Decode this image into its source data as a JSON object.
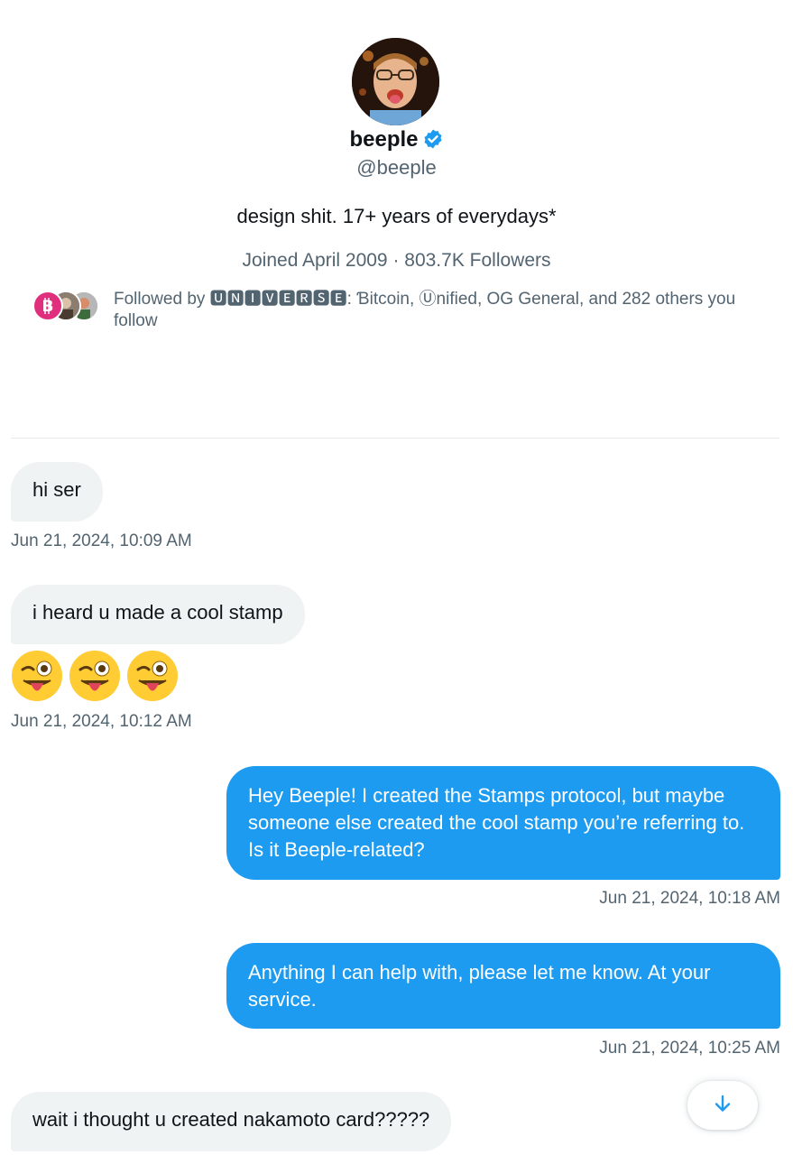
{
  "profile": {
    "name": "beeple",
    "handle": "@beeple",
    "bio": "design shit. 17+ years of everydays*",
    "meta": "Joined April 2009 · 803.7K Followers",
    "followed_by": "Followed by 🆄🅽🅸🆅🅴🆁🆂🅴: Ɓitcoin, Ⓤnified, OG General, and 282 others you follow"
  },
  "messages": [
    {
      "direction": "in",
      "text": "hi ser",
      "timestamp": "Jun 21, 2024, 10:09 AM"
    },
    {
      "direction": "in",
      "text": "i heard u made a cool stamp",
      "timestamp": ""
    },
    {
      "direction": "in",
      "emoji": "winking-face-with-tongue",
      "count": 3,
      "timestamp": "Jun 21, 2024, 10:12 AM"
    },
    {
      "direction": "out",
      "text": "Hey Beeple! I created the Stamps protocol, but maybe someone else created the cool stamp you’re referring to. Is it Beeple-related?",
      "timestamp": "Jun 21, 2024, 10:18 AM"
    },
    {
      "direction": "out",
      "text": "Anything I can help with, please let me know. At your service.",
      "timestamp": "Jun 21, 2024, 10:25 AM"
    },
    {
      "direction": "in",
      "text": "wait i thought u created nakamoto card?????",
      "timestamp": ""
    }
  ],
  "colors": {
    "accent": "#1d9bf0",
    "incoming_bubble": "#eff3f4",
    "secondary_text": "#536471",
    "primary_text": "#0f1419",
    "bitcoin_avatar": "#e0307d"
  },
  "icons": {
    "verified": "verified-badge-icon",
    "scroll_down": "arrow-down-icon"
  }
}
